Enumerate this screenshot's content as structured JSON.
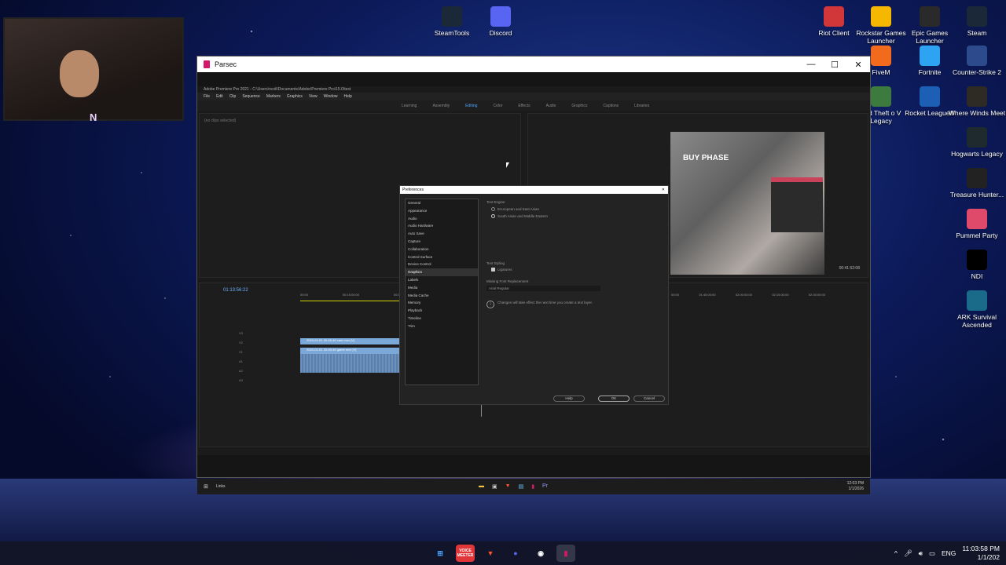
{
  "desktop": {
    "icons": [
      {
        "label": "SteamTools",
        "icon": "steamtools-icon",
        "color": "#1b2838"
      },
      {
        "label": "Discord",
        "icon": "discord-icon",
        "color": "#5865f2"
      },
      {
        "label": "Riot Client",
        "icon": "riot-icon",
        "color": "#d13639"
      },
      {
        "label": "Rockstar Games Launcher",
        "icon": "rockstar-icon",
        "color": "#f5b700"
      },
      {
        "label": "Epic Games Launcher",
        "icon": "epic-icon",
        "color": "#2a2a2a"
      },
      {
        "label": "Steam",
        "icon": "steam-icon",
        "color": "#1b2838"
      },
      {
        "label": "FiveM",
        "icon": "fivem-icon",
        "color": "#f26b1d"
      },
      {
        "label": "Fortnite",
        "icon": "fortnite-icon",
        "color": "#2ea3f2"
      },
      {
        "label": "Counter-Strike 2",
        "icon": "cs2-icon",
        "color": "#2d4b8c"
      },
      {
        "label": "and Theft o V Legacy",
        "icon": "gta-icon",
        "color": "#3d7a3d"
      },
      {
        "label": "Rocket League®",
        "icon": "rocket-league-icon",
        "color": "#1d5fb4"
      },
      {
        "label": "Where Winds Meet",
        "icon": "where-winds-meet-icon",
        "color": "#2e2a24"
      },
      {
        "label": "Hogwarts Legacy",
        "icon": "hogwarts-icon",
        "color": "#1f2a2e"
      },
      {
        "label": "Treasure Hunter...",
        "icon": "treasure-hunter-icon",
        "color": "#222222"
      },
      {
        "label": "Pummel Party",
        "icon": "pummel-party-icon",
        "color": "#e04a6a"
      },
      {
        "label": "NDI",
        "icon": "ndi-icon",
        "color": "#000000"
      },
      {
        "label": "ARK Survival Ascended",
        "icon": "ark-icon",
        "color": "#1a6a8a"
      }
    ]
  },
  "webcam": {
    "badge": "N"
  },
  "parsec": {
    "title": "Parsec",
    "controls": [
      "—",
      "☐",
      "✕"
    ]
  },
  "premiere": {
    "title": "Adobe Premiere Pro 2021 - C:\\Users\\ncoli\\Documents\\Adobe\\Premiere Pro\\15.0\\test",
    "menu": [
      "File",
      "Edit",
      "Clip",
      "Sequence",
      "Markers",
      "Graphics",
      "View",
      "Window",
      "Help"
    ],
    "workspaces": [
      "Learning",
      "Assembly",
      "Editing",
      "Color",
      "Effects",
      "Audio",
      "Graphics",
      "Captions",
      "Libraries"
    ],
    "active_workspace": "Editing",
    "source_panel": "(no clips selected)",
    "preview_overlay": "BUY PHASE",
    "program_timecode": "00:41:52:08",
    "timeline_timecode": "01:13:56:22",
    "ruler": [
      "00:00",
      "00:15:00:00",
      "00:30:00:00"
    ],
    "ruler_right": [
      "00:00",
      "01:45:00:00",
      "02:00:00:00",
      "02:15:00:00",
      "02:30:00:00"
    ],
    "tracks": [
      "V3",
      "V2",
      "V1",
      "A1",
      "A2",
      "A3"
    ],
    "clips": [
      "2024-01-01 20-45-46 cam.mov [V]",
      "2024-01-01 20-45-46 game.mov [V]"
    ]
  },
  "preferences": {
    "title": "Preferences",
    "categories": [
      "General",
      "Appearance",
      "Audio",
      "Audio Hardware",
      "Auto Save",
      "Capture",
      "Collaboration",
      "Control Surface",
      "Device Control",
      "Graphics",
      "Labels",
      "Media",
      "Media Cache",
      "Memory",
      "Playback",
      "Timeline",
      "Trim"
    ],
    "selected": "Graphics",
    "text_engine_label": "Text Engine",
    "engine_opt1": "Ecuropean and East Asian",
    "engine_opt2": "South Asian and Middle Eastern",
    "text_styling_label": "Text Styling",
    "ligatures": "Ligatures",
    "missing_font_label": "Missing Font Replacement",
    "missing_font_value": "Arial Regular",
    "info_text": "Changes will take effect the next time you create a text layer.",
    "help_btn": "Help",
    "ok_btn": "OK",
    "cancel_btn": "Cancel"
  },
  "remote_taskbar": {
    "links": "Links",
    "time": "12:03 PM",
    "date": "1/1/2026"
  },
  "taskbar": {
    "apps": [
      {
        "name": "start-button",
        "label": "⊞",
        "color": "#4aa3ff"
      },
      {
        "name": "voicemeeter-app",
        "label": "VOICE MEETER",
        "color": "#e0363a"
      },
      {
        "name": "brave-app",
        "label": "▼",
        "color": "#fb542b"
      },
      {
        "name": "discord-app",
        "label": "●",
        "color": "#5865f2"
      },
      {
        "name": "obs-app",
        "label": "◉",
        "color": "#ffffff"
      },
      {
        "name": "parsec-app",
        "label": "▮",
        "color": "#d4176a"
      }
    ],
    "lang": "ENG",
    "time": "11:03:58 PM",
    "date": "1/1/202"
  }
}
